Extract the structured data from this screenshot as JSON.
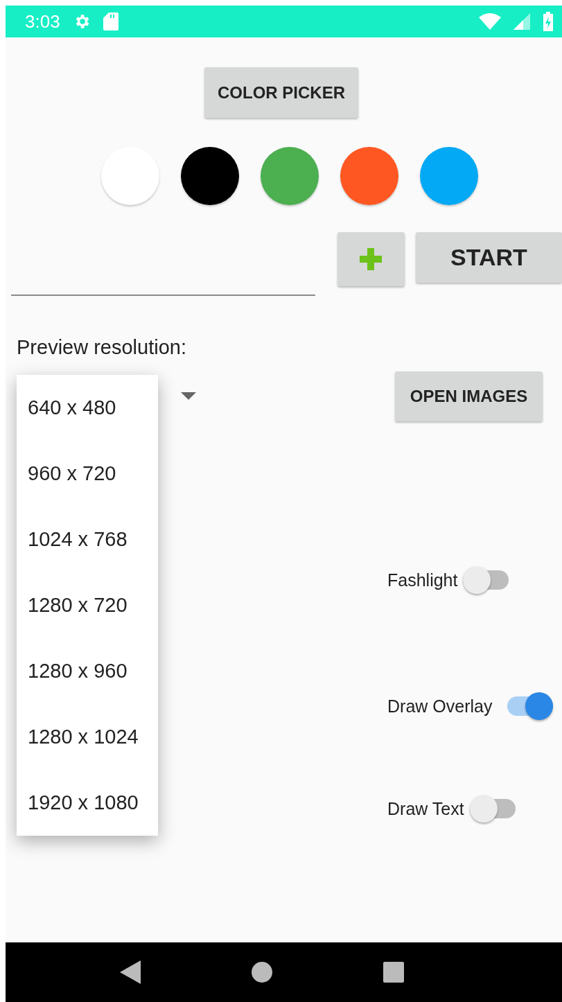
{
  "status_bar": {
    "time": "3:03"
  },
  "color_picker_button": "COLOR PICKER",
  "colors": [
    {
      "color": "#ffffff"
    },
    {
      "color": "#000000"
    },
    {
      "color": "#4caf50"
    },
    {
      "color": "#ff5722"
    },
    {
      "color": "#03a9f4"
    }
  ],
  "start_button": "START",
  "preview_label": "Preview resolution:",
  "resolution_dropdown": {
    "expanded": true,
    "options": [
      "640 x 480",
      "960 x 720",
      "1024 x 768",
      "1280 x 720",
      "1280 x 960",
      "1280 x 1024",
      "1920 x 1080"
    ]
  },
  "open_images_button": "OPEN IMAGES",
  "switches": [
    {
      "label": "Fashlight",
      "on": false
    },
    {
      "label": "Draw Overlay",
      "on": true
    },
    {
      "label": "Draw Text",
      "on": false
    }
  ]
}
